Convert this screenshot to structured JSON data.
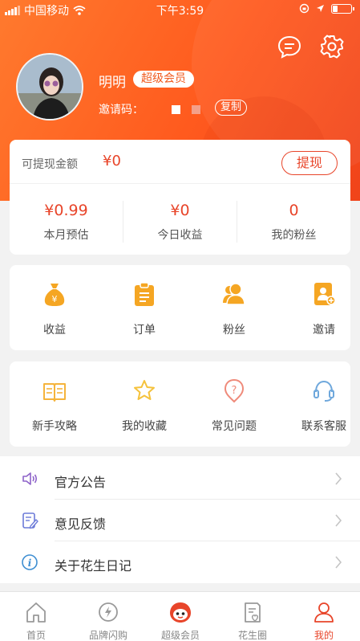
{
  "status_bar": {
    "carrier": "中国移动",
    "time": "下午3:59"
  },
  "profile": {
    "name": "明明",
    "vip_label": "超级会员",
    "invite_label": "邀请码：",
    "copy_label": "复制"
  },
  "earnings": {
    "withdrawable_label": "可提现金额",
    "withdrawable_amount": "¥0",
    "withdraw_button": "提现",
    "stats": [
      {
        "value": "¥0.99",
        "label": "本月预估"
      },
      {
        "value": "¥0",
        "label": "今日收益"
      },
      {
        "value": "0",
        "label": "我的粉丝"
      }
    ]
  },
  "quick_actions": [
    {
      "label": "收益",
      "icon": "money-bag-icon"
    },
    {
      "label": "订单",
      "icon": "clipboard-icon"
    },
    {
      "label": "粉丝",
      "icon": "fans-icon"
    },
    {
      "label": "邀请",
      "icon": "invite-icon"
    }
  ],
  "services": [
    {
      "label": "新手攻略",
      "icon": "book-icon"
    },
    {
      "label": "我的收藏",
      "icon": "star-icon"
    },
    {
      "label": "常见问题",
      "icon": "question-icon"
    },
    {
      "label": "联系客服",
      "icon": "headset-icon"
    }
  ],
  "menu": [
    {
      "label": "官方公告",
      "icon": "speaker-icon"
    },
    {
      "label": "意见反馈",
      "icon": "feedback-icon"
    },
    {
      "label": "关于花生日记",
      "icon": "info-icon"
    }
  ],
  "tabbar": [
    {
      "label": "首页",
      "icon": "home-icon",
      "active": false
    },
    {
      "label": "品牌闪购",
      "icon": "flash-icon",
      "active": false
    },
    {
      "label": "超级会员",
      "icon": "mascot-icon",
      "active": false
    },
    {
      "label": "花生圈",
      "icon": "circle-icon",
      "active": false
    },
    {
      "label": "我的",
      "icon": "user-icon",
      "active": true
    }
  ],
  "colors": {
    "brand": "#f05a1e",
    "accent_red": "#e8452a",
    "gold": "#f5a623"
  }
}
